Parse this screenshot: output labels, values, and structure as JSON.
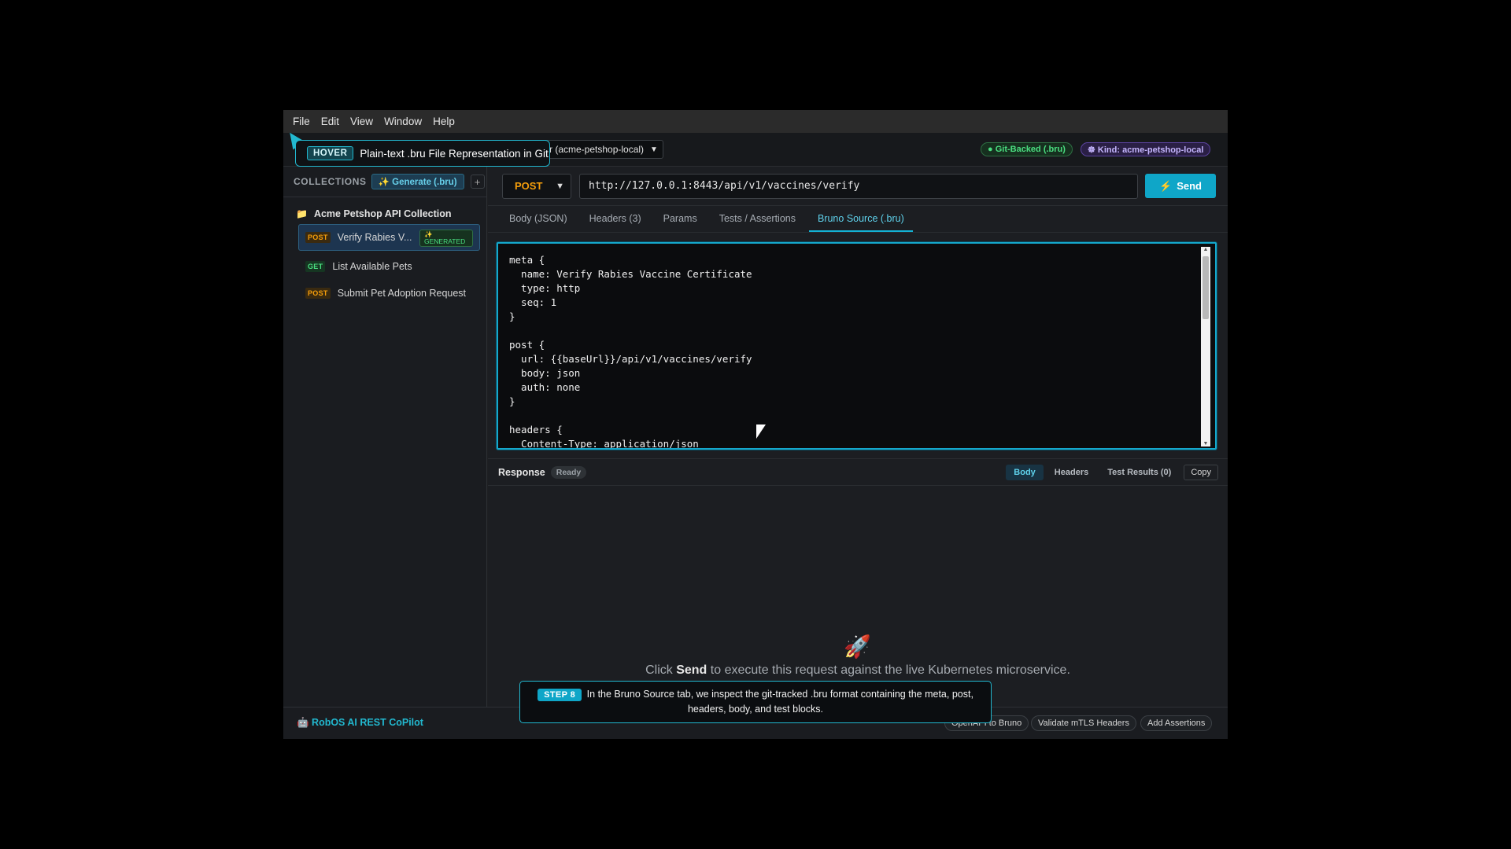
{
  "menubar": [
    "File",
    "Edit",
    "View",
    "Window",
    "Help"
  ],
  "hover": {
    "tag": "HOVER",
    "text": "Plain-text .bru File Representation in Git"
  },
  "toolbar": {
    "env_select": "r (acme-petshop-local)",
    "git_badge": "● Git-Backed (.bru)",
    "kind_badge": "☸ Kind: acme-petshop-local"
  },
  "sidebar": {
    "header_label": "COLLECTIONS",
    "generate_label": "✨ Generate (.bru)",
    "add_label": "+",
    "collection_title": "Acme Petshop API Collection",
    "items": [
      {
        "method": "POST",
        "label": "Verify Rabies V...",
        "badge": "✨ GENERATED"
      },
      {
        "method": "GET",
        "label": "List Available Pets"
      },
      {
        "method": "POST",
        "label": "Submit Pet Adoption Request"
      }
    ]
  },
  "request": {
    "method": "POST",
    "url": "http://127.0.0.1:8443/api/v1/vaccines/verify",
    "send_label": "Send"
  },
  "tabs": [
    "Body (JSON)",
    "Headers (3)",
    "Params",
    "Tests / Assertions",
    "Bruno Source (.bru)"
  ],
  "editor": {
    "code": "meta {\n  name: Verify Rabies Vaccine Certificate\n  type: http\n  seq: 1\n}\n\npost {\n  url: {{baseUrl}}/api/v1/vaccines/verify\n  body: json\n  auth: none\n}\n\nheaders {\n  Content-Type: application/json"
  },
  "response": {
    "title": "Response",
    "status": "Ready",
    "tabs": [
      "Body",
      "Headers",
      "Test Results (0)"
    ],
    "copy_label": "Copy",
    "empty_prefix": "Click ",
    "empty_bold": "Send",
    "empty_suffix": " to execute this request against the live Kubernetes microservice."
  },
  "footer": {
    "brand": "🤖 RobOS AI REST CoPilot",
    "buttons": [
      "OpenAPI to Bruno",
      "Validate mTLS Headers",
      "Add Assertions"
    ]
  },
  "step": {
    "tag": "STEP 8",
    "text": "In the Bruno Source tab, we inspect the git-tracked .bru format containing the meta, post, headers, body, and test blocks."
  }
}
